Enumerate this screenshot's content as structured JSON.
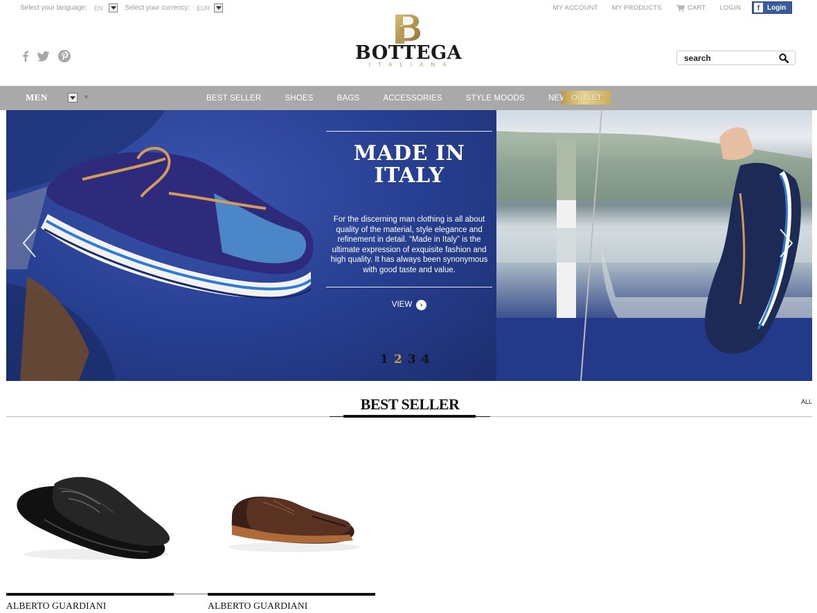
{
  "topbar": {
    "language_label": "Select your language:",
    "language_value": "EN",
    "currency_label": "Select your currency:",
    "currency_value": "EUR",
    "links": [
      "MY ACCOUNT",
      "MY PRODUCTS",
      "CART",
      "LOGIN"
    ],
    "facebook_login": "Login"
  },
  "header": {
    "logo_word": "BOTTEGA",
    "logo_sub": "ITALIANA",
    "search_placeholder": "search",
    "social_icons": [
      "facebook-icon",
      "twitter-icon",
      "pinterest-icon"
    ]
  },
  "nav": {
    "section": "MEN",
    "items": [
      "BEST SELLER",
      "SHOES",
      "BAGS",
      "ACCESSORIES",
      "STYLE MOODS",
      "NEWS"
    ],
    "outlet": "OUTLET"
  },
  "hero": {
    "title_line1": "MADE IN",
    "title_line2": "ITALY",
    "body": "For the discerning man clothing is all about quality of the material, style elegance and refinement in detail. “Made in Italy” is the ultimate expression of exquisite fashion and high quality. It has always been synonymous with good taste and value.",
    "cta": "VIEW",
    "pages": [
      "1",
      "2",
      "3",
      "4"
    ],
    "active_page": "2"
  },
  "best_seller": {
    "title": "BEST SELLER",
    "all_link": "ALL",
    "products": [
      {
        "brand": "ALBERTO GUARDIANI",
        "color": "#1c1c1c"
      },
      {
        "brand": "ALBERTO GUARDIANI",
        "color": "#5a3222"
      }
    ]
  },
  "colors": {
    "nav_bg": "#a9a9a9",
    "accent_gold": "#c9a24a",
    "hero_blue": "#263e8f",
    "facebook_blue": "#3b5a99"
  }
}
